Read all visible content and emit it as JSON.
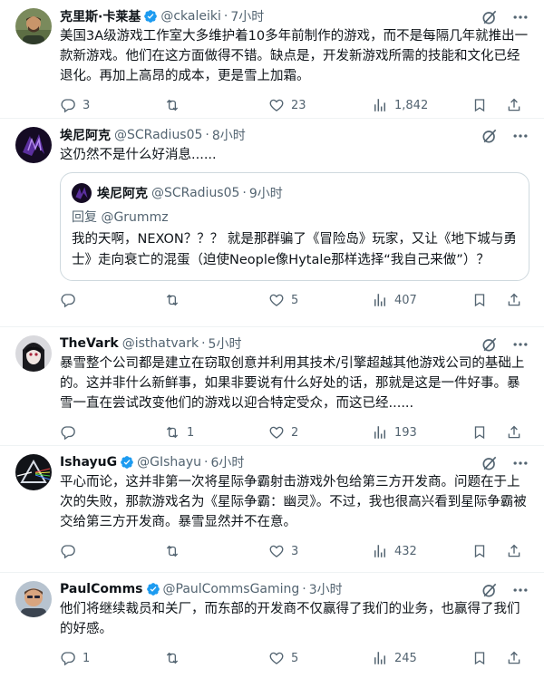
{
  "icons": {
    "verified": "verified-badge-icon",
    "grok": "grok-icon",
    "more": "more-options-icon",
    "reply": "reply-icon",
    "retweet": "retweet-icon",
    "like": "like-icon",
    "views": "views-icon",
    "share": "share-icon"
  },
  "colors": {
    "accent": "#1d9bf0",
    "muted": "#536471",
    "border": "#eff3f4"
  },
  "tweets": [
    {
      "name": "克里斯·卡莱基",
      "handle": "@ckaleiki",
      "dot": "·",
      "time": "7小时",
      "text": "美国3A级游戏工作室大多维护着10多年前制作的游戏，而不是每隔几年就推出一款新游戏。他们在这方面做得不错。缺点是，开发新游戏所需的技能和文化已经退化。再加上高昂的成本，更是雪上加霜。",
      "replies": "3",
      "retweets": "",
      "likes": "23",
      "views": "1,842"
    },
    {
      "name": "埃尼阿克",
      "handle": "@SCRadius05",
      "dot": "·",
      "time": "8小时",
      "text": "这仍然不是什么好消息......",
      "quote": {
        "name": "埃尼阿克",
        "handle": "@SCRadius05",
        "dot": "·",
        "time": "9小时",
        "reply_to": "回复 @Grummz",
        "text": "我的天啊，NEXON？？？ 就是那群骗了《冒险岛》玩家，又让《地下城与勇士》走向衰亡的混蛋（迫使Neople像Hytale那样选择“我自己来做”）？"
      },
      "replies": "",
      "retweets": "",
      "likes": "5",
      "views": "407"
    },
    {
      "name": "TheVark",
      "handle": "@isthatvark",
      "dot": "·",
      "time": "5小时",
      "text": "暴雪整个公司都是建立在窃取创意并利用其技术/引擎超越其他游戏公司的基础上的。这并非什么新鲜事，如果非要说有什么好处的话，那就是这是一件好事。暴雪一直在尝试改变他们的游戏以迎合特定受众，而这已经......",
      "replies": "",
      "retweets": "1",
      "likes": "2",
      "views": "193"
    },
    {
      "name": "IshayuG",
      "handle": "@GIshayu",
      "dot": "·",
      "time": "6小时",
      "text": "平心而论，这并非第一次将星际争霸射击游戏外包给第三方开发商。问题在于上次的失败，那款游戏名为《星际争霸：幽灵》。不过，我也很高兴看到星际争霸被交给第三方开发商。暴雪显然并不在意。",
      "replies": "",
      "retweets": "",
      "likes": "3",
      "views": "432"
    },
    {
      "name": "PaulComms",
      "handle": "@PaulCommsGaming",
      "dot": "·",
      "time": "3小时",
      "text": "他们将继续裁员和关厂，而东部的开发商不仅赢得了我们的业务，也赢得了我们的好感。",
      "replies": "1",
      "retweets": "",
      "likes": "5",
      "views": "245"
    }
  ]
}
